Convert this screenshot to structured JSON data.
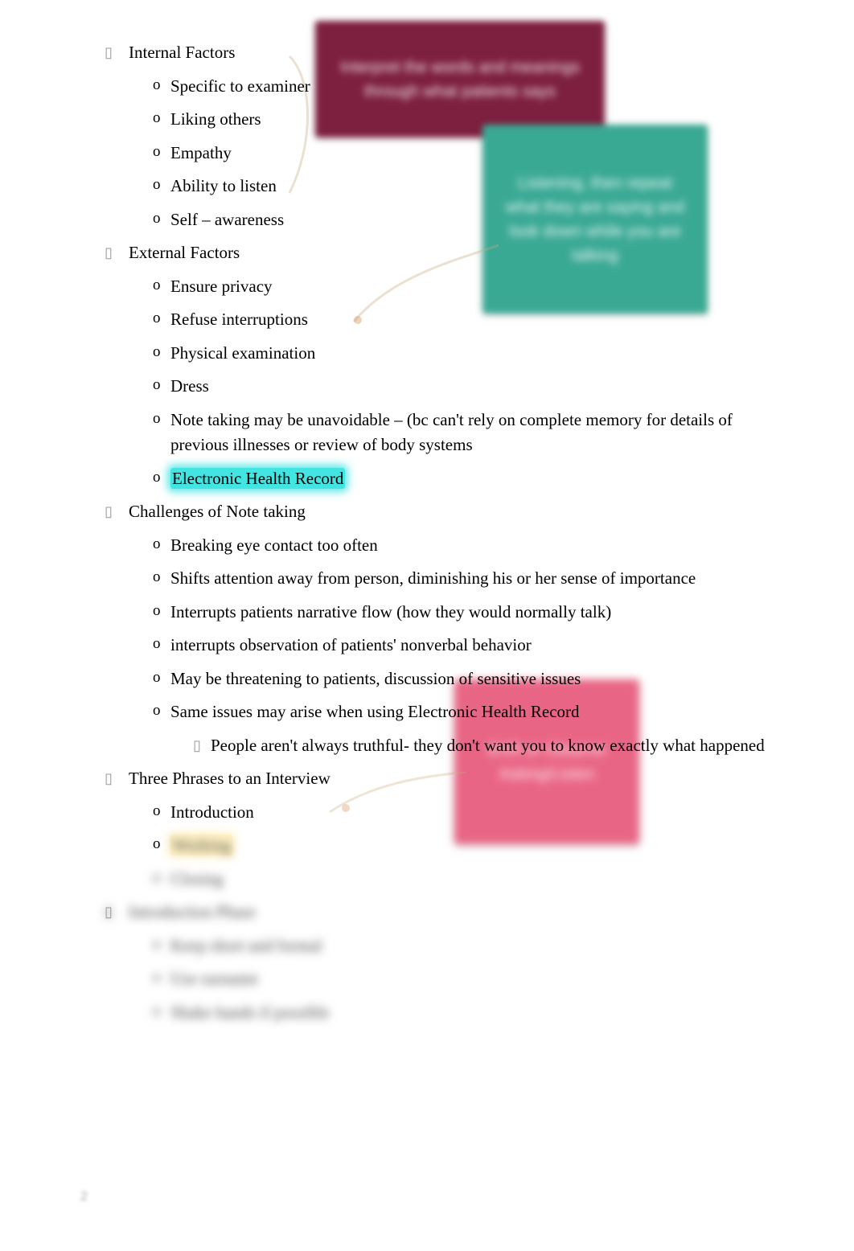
{
  "sections": {
    "internal": {
      "title": "Internal Factors",
      "items": [
        "Specific to examiner",
        "Liking others",
        "Empathy",
        "Ability to listen",
        "Self – awareness"
      ]
    },
    "external": {
      "title": "External Factors",
      "items": [
        "Ensure privacy",
        "Refuse interruptions",
        "Physical examination",
        "Dress",
        "Note taking may be unavoidable – (bc can't rely on complete memory for details of previous illnesses or review of body systems",
        "Electronic Health Record"
      ]
    },
    "challenges": {
      "title": "Challenges of Note taking",
      "items": [
        "Breaking eye contact too often",
        "Shifts attention away from person, diminishing his or her sense of importance",
        "Interrupts patients narrative flow (how they would normally talk)",
        "interrupts observation of patients' nonverbal behavior",
        "May be threatening to patients, discussion of sensitive issues",
        "Same issues may arise when using Electronic Health Record"
      ],
      "sub": "People aren't always truthful- they don't want you to know exactly what happened"
    },
    "phases": {
      "title": "Three Phrases to an Interview",
      "items": [
        "Introduction",
        "Working",
        "Closing"
      ]
    },
    "intro_phase": {
      "title": "Introduction Phase",
      "items": [
        "Keep short and formal",
        "Use surname",
        "Shake hands if possible"
      ]
    }
  },
  "callouts": {
    "maroon": "Interpret the words and meanings through what patients says",
    "teal": "Listening, then repeat what they are saying and look down while you are talking",
    "pink": "EHR or Observe Asking/Listen"
  },
  "page_num": "2"
}
